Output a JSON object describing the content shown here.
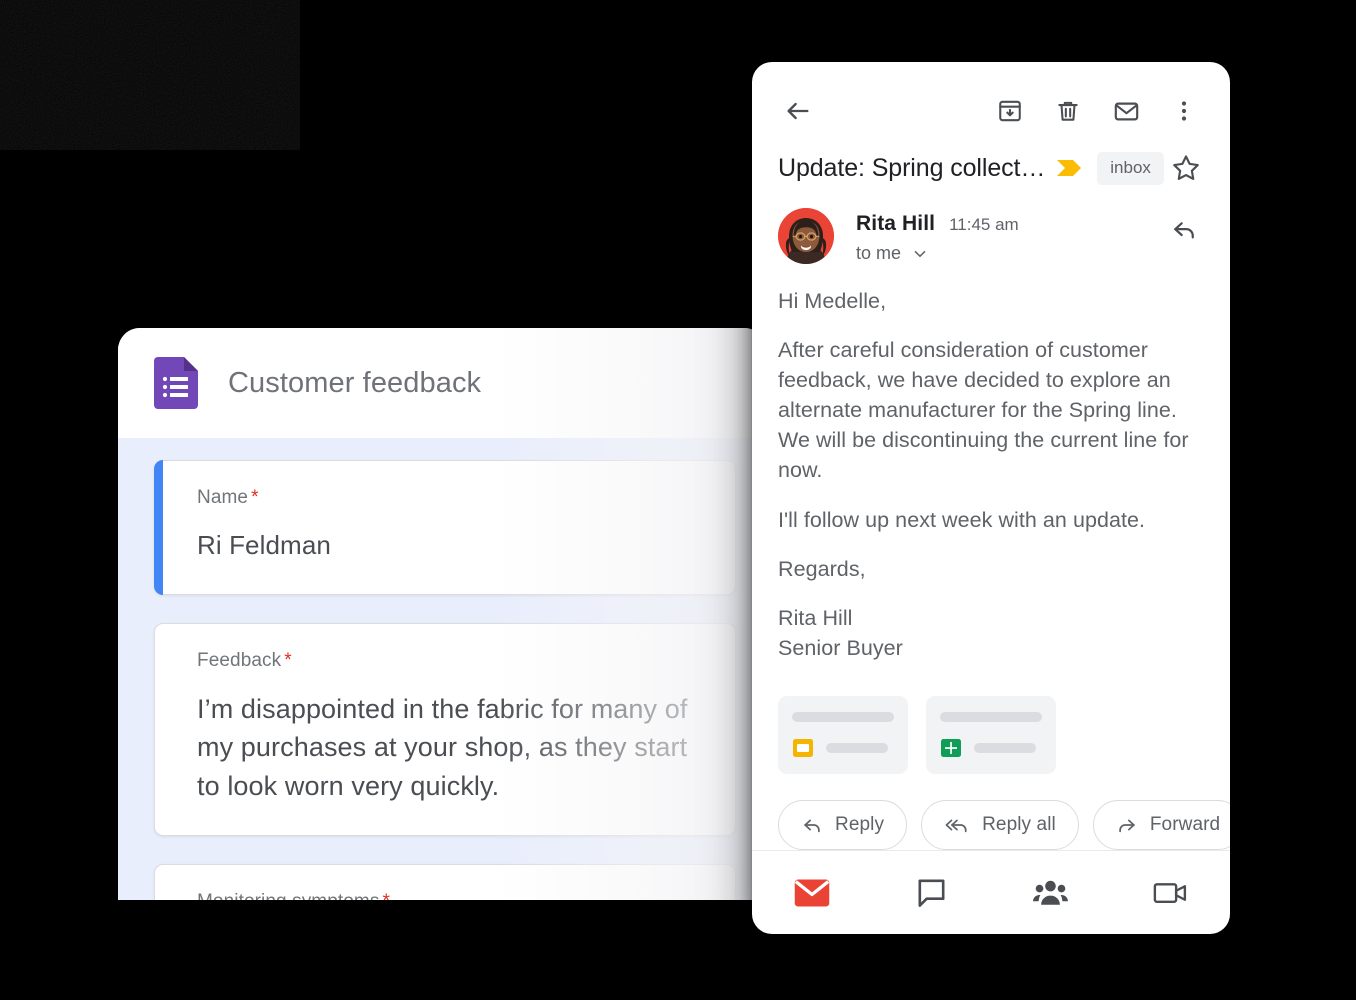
{
  "colors": {
    "background": "#000000",
    "gmail_red": "#ea4335",
    "forms_purple": "#7248b9",
    "slides_yellow": "#f5b400",
    "sheets_green": "#0f9d58",
    "forms_accent_blue": "#4285f4",
    "forms_body_bg": "#e9eefc",
    "importance_yellow": "#fbbc04",
    "required_red": "#d93025",
    "icon_grey": "#5f6368",
    "chip_grey": "#f1f3f4"
  },
  "forms": {
    "app_icon": "google-forms-icon",
    "title": "Customer feedback",
    "questions": [
      {
        "label": "Name",
        "required_marker": "*",
        "answer": "Ri Feldman",
        "active": true
      },
      {
        "label": "Feedback",
        "required_marker": "*",
        "answer": "I’m disappointed in the fabric for many of my purchases at your shop, as they start to look worn very quickly.",
        "active": false
      },
      {
        "label": "Monitoring symptoms",
        "required_marker": "*",
        "answer": "",
        "active": false
      }
    ]
  },
  "gmail": {
    "toolbar": {
      "back": "back-arrow-icon",
      "archive": "archive-icon",
      "delete": "delete-icon",
      "mark_unread": "mark-unread-icon",
      "more": "more-vertical-icon"
    },
    "subject": "Update: Spring collect…",
    "importance_marker": "importance-marker-icon",
    "label_chip": "inbox",
    "star": "star-outline-icon",
    "sender": {
      "avatar": "avatar-rita-hill",
      "name": "Rita Hill",
      "time": "11:45 am",
      "recipient": "to me",
      "expand": "chevron-down-icon",
      "reply_shortcut": "reply-arrow-icon"
    },
    "body": {
      "greeting": "Hi Medelle,",
      "paragraph1": "After careful consideration of customer feedback, we have decided to explore an alternate manufacturer for the Spring line. We will be discontinuing the current line for now.",
      "paragraph2": "I'll follow up next week with an update.",
      "signoff": "Regards,",
      "signature_name": "Rita Hill",
      "signature_title": "Senior Buyer"
    },
    "attachments": [
      {
        "icon": "google-slides-icon"
      },
      {
        "icon": "google-sheets-icon"
      }
    ],
    "actions": [
      {
        "label": "Reply",
        "icon": "reply-icon"
      },
      {
        "label": "Reply all",
        "icon": "reply-all-icon"
      },
      {
        "label": "Forward",
        "icon": "forward-icon"
      }
    ],
    "bottom_nav": [
      {
        "name": "mail",
        "icon": "mail-icon",
        "active": true
      },
      {
        "name": "chat",
        "icon": "chat-bubble-icon",
        "active": false
      },
      {
        "name": "spaces",
        "icon": "spaces-people-icon",
        "active": false
      },
      {
        "name": "meet",
        "icon": "video-camera-icon",
        "active": false
      }
    ]
  }
}
